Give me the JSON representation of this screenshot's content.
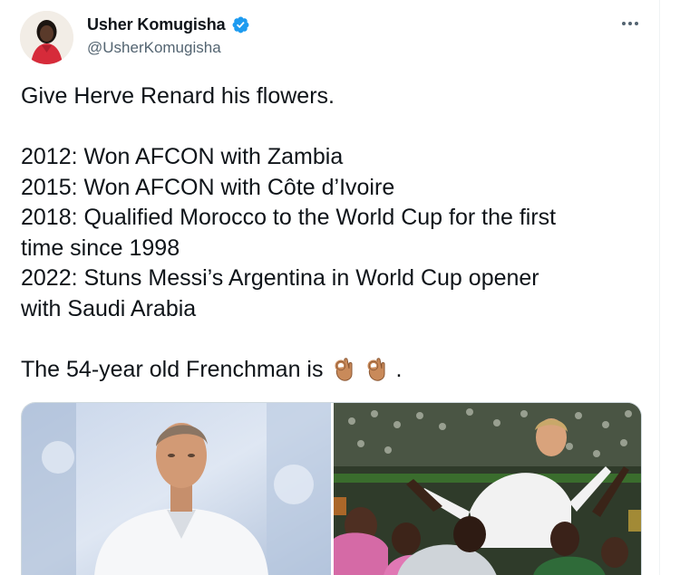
{
  "author": {
    "display_name": "Usher Komugisha",
    "handle": "@UsherKomugisha",
    "verified": true
  },
  "tweet": {
    "lines": [
      "Give Herve Renard his flowers.",
      "",
      "2012: Won AFCON with Zambia",
      "2015: Won AFCON with Côte d’Ivoire",
      "2018: Qualified Morocco to the World Cup for the first",
      "time since 1998",
      "2022: Stuns Messi’s Argentina in World Cup opener",
      "with Saudi Arabia",
      "",
      "The 54-year old Frenchman is"
    ],
    "trailing_punct": ".",
    "emojis": [
      "ok-hand-icon",
      "ok-hand-icon"
    ]
  },
  "colors": {
    "verified_blue": "#1d9bf0",
    "text": "#0f1419",
    "secondary": "#536471",
    "border": "#cfd9de"
  },
  "media": {
    "photos": [
      "photo-coach-portrait",
      "photo-celebration"
    ]
  }
}
